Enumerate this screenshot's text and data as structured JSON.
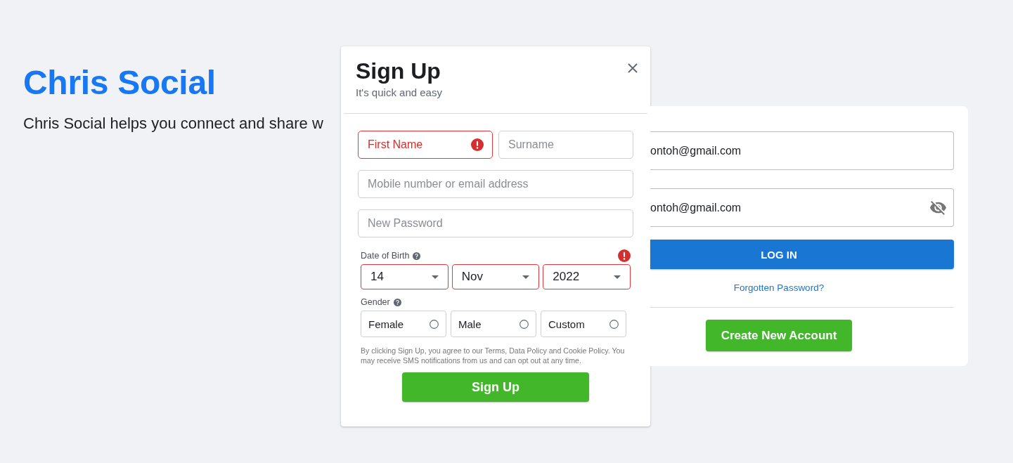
{
  "brand": {
    "title": "Chris Social",
    "tagline": "Chris Social helps you connect and share w"
  },
  "signup_dialog": {
    "title": "Sign Up",
    "subtitle": "It's quick and easy",
    "name_fields": [
      {
        "placeholder": "First Name",
        "error": true
      },
      {
        "placeholder": "Surname",
        "error": false
      }
    ],
    "fields": [
      {
        "placeholder": "Mobile number or email address",
        "error": false
      },
      {
        "placeholder": "New Password",
        "error": false
      }
    ],
    "birth_date": {
      "label": "Date of Birth",
      "error": true,
      "selects": [
        {
          "value": "14"
        },
        {
          "value": "Nov"
        },
        {
          "value": "2022"
        }
      ]
    },
    "gender": {
      "label": "Gender",
      "options": [
        {
          "label": "Female",
          "selected": false
        },
        {
          "label": "Male",
          "selected": false
        },
        {
          "label": "Custom",
          "selected": false
        }
      ]
    },
    "legal_text": "By clicking Sign Up, you agree to our Terms, Data Policy and Cookie Policy. You may receive SMS notifications from us and can opt out at any time.",
    "submit_button": "Sign Up"
  },
  "login_card": {
    "fields": [
      {
        "kind": "email",
        "value": "ontoh@gmail.com"
      },
      {
        "kind": "password",
        "value": "ontoh@gmail.com"
      }
    ],
    "login_button": "LOG IN",
    "forgot_link": "Forgotten Password?",
    "create_button": "Create New Account"
  }
}
